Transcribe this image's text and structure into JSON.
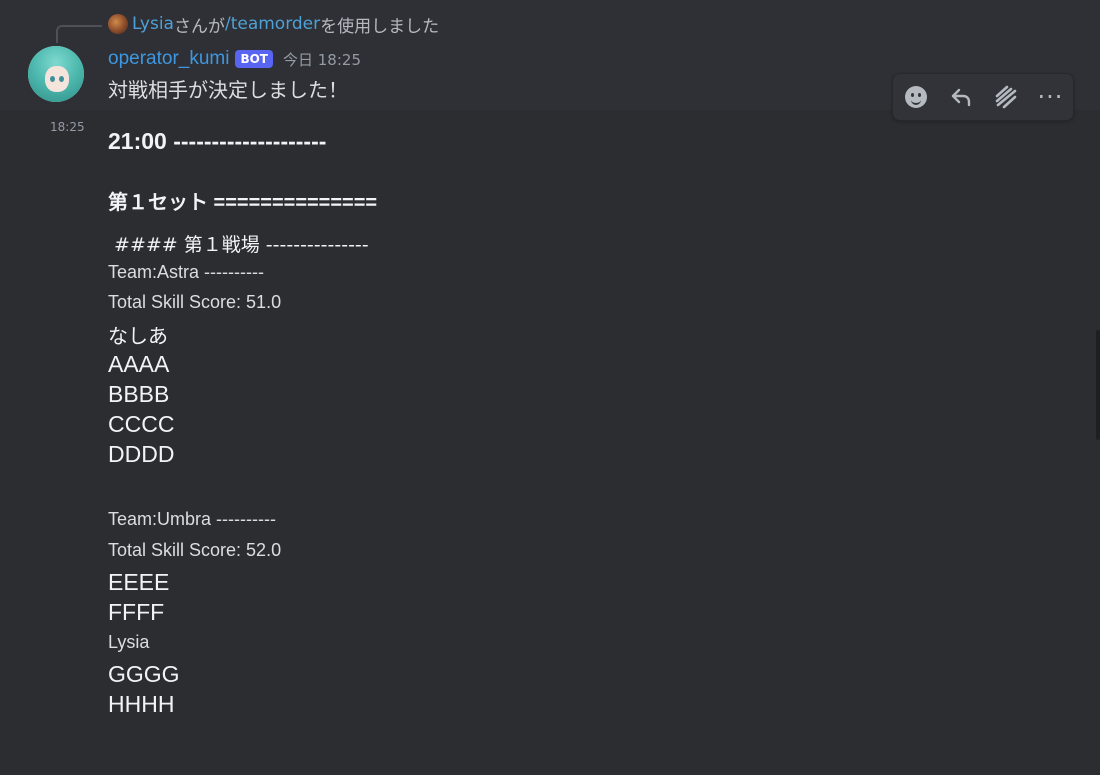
{
  "command": {
    "user": "Lysia",
    "connector": "さんが",
    "command_name": "/teamorder",
    "suffix": "を使用しました"
  },
  "message": {
    "username": "operator_kumi",
    "badge": "BOT",
    "timestamp": "今日 18:25",
    "side_time": "18:25",
    "first_line": "対戦相手が決定しました！"
  },
  "toolbar": {
    "items": [
      "add-reaction",
      "reply",
      "create-thread",
      "more"
    ],
    "more_label": "···"
  },
  "content": {
    "time_header": "21:00 --------------------",
    "set_header": "第１セット ==============",
    "battlefield": " #### 第１戦場 ---------------",
    "teams": [
      {
        "name": "Team:Astra ----------",
        "score": "Total Skill Score: 51.0",
        "members": [
          "なしあ",
          "AAAA",
          "BBBB",
          "CCCC",
          "DDDD"
        ]
      },
      {
        "name": "Team:Umbra ----------",
        "score": "Total Skill Score: 52.0",
        "members": [
          "EEEE",
          "FFFF",
          "Lysia",
          "GGGG",
          "HHHH"
        ]
      }
    ]
  },
  "colors": {
    "background": "#313338",
    "username": "#3e97e0",
    "bot_badge": "#5865f2",
    "command_link": "#4ea0d6"
  }
}
